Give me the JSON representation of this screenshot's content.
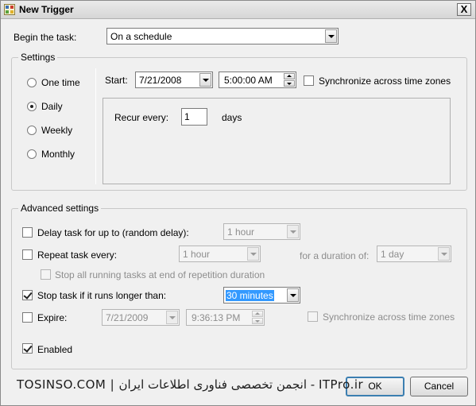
{
  "window": {
    "title": "New Trigger",
    "close_label": "X"
  },
  "begin_task": {
    "label": "Begin the task:",
    "value": "On a schedule"
  },
  "settings": {
    "group_title": "Settings",
    "frequency_options": [
      "One time",
      "Daily",
      "Weekly",
      "Monthly"
    ],
    "selected_frequency": "Daily",
    "start_label": "Start:",
    "start_date": "7/21/2008",
    "start_time": "5:00:00 AM",
    "sync_label": "Synchronize across time zones",
    "recur_label": "Recur every:",
    "recur_value": "1",
    "recur_unit": "days"
  },
  "advanced": {
    "group_title": "Advanced settings",
    "delay_label": "Delay task for up to (random delay):",
    "delay_value": "1 hour",
    "repeat_label": "Repeat task every:",
    "repeat_value": "1 hour",
    "duration_label": "for a duration of:",
    "duration_value": "1 day",
    "stop_running_label": "Stop all running tasks at end of repetition duration",
    "stop_if_label": "Stop task if it runs longer than:",
    "stop_if_value": "30 minutes",
    "expire_label": "Expire:",
    "expire_date": "7/21/2009",
    "expire_time": "9:36:13 PM",
    "expire_sync_label": "Synchronize across time zones",
    "enabled_label": "Enabled"
  },
  "buttons": {
    "ok": "OK",
    "cancel": "Cancel"
  },
  "watermark": "TOSINSO.COM | انجمن تخصصی فناوری اطلاعات ایران - ITPro.ir"
}
